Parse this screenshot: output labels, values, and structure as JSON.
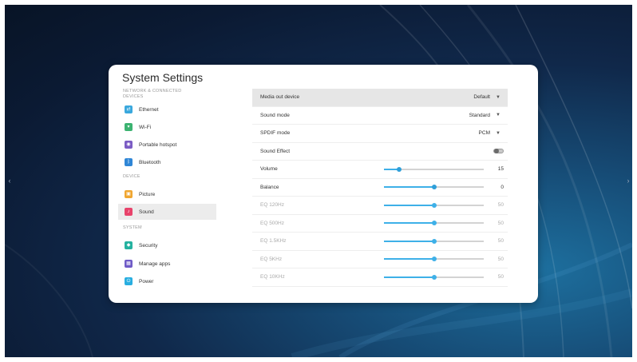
{
  "sidebar": {
    "title": "System Settings",
    "sections": [
      {
        "header": "NETWORK & CONNECTED DEVICES",
        "items": [
          {
            "label": "Ethernet",
            "icon": "ethernet-icon",
            "color": "#3aa8dd"
          },
          {
            "label": "Wi-Fi",
            "icon": "wifi-icon",
            "color": "#3cb371"
          },
          {
            "label": "Portable hotspot",
            "icon": "hotspot-icon",
            "color": "#7b5cc4"
          },
          {
            "label": "Bluetooth",
            "icon": "bluetooth-icon",
            "color": "#2f86d6"
          }
        ]
      },
      {
        "header": "DEVICE",
        "items": [
          {
            "label": "Picture",
            "icon": "picture-icon",
            "color": "#f0a630"
          },
          {
            "label": "Sound",
            "icon": "sound-icon",
            "color": "#e8436b",
            "active": true
          }
        ]
      },
      {
        "header": "SYSTEM",
        "items": [
          {
            "label": "Security",
            "icon": "security-icon",
            "color": "#25b2a0"
          },
          {
            "label": "Manage apps",
            "icon": "apps-icon",
            "color": "#6f5bc7"
          },
          {
            "label": "Power",
            "icon": "power-icon",
            "color": "#28aee0"
          }
        ]
      }
    ]
  },
  "sound": {
    "media_out_device": {
      "label": "Media out device",
      "value": "Default"
    },
    "sound_mode": {
      "label": "Sound mode",
      "value": "Standard"
    },
    "spdif_mode": {
      "label": "SPDIF mode",
      "value": "PCM"
    },
    "sound_effect": {
      "label": "Sound Effect",
      "on": false
    },
    "sliders": [
      {
        "label": "Volume",
        "value": "15",
        "level": 0.15,
        "enabled": true
      },
      {
        "label": "Balance",
        "value": "0",
        "level": 0.5,
        "enabled": true
      },
      {
        "label": "EQ 120Hz",
        "value": "50",
        "level": 0.5,
        "enabled": false
      },
      {
        "label": "EQ 500Hz",
        "value": "50",
        "level": 0.5,
        "enabled": false
      },
      {
        "label": "EQ 1.5KHz",
        "value": "50",
        "level": 0.5,
        "enabled": false
      },
      {
        "label": "EQ 5KHz",
        "value": "50",
        "level": 0.5,
        "enabled": false
      },
      {
        "label": "EQ 10KHz",
        "value": "50",
        "level": 0.5,
        "enabled": false
      }
    ]
  },
  "icons": {
    "dropdown": "dropdown-icon",
    "edge_left": "chevron-left-icon",
    "edge_right": "chevron-right-icon"
  },
  "colors": {
    "accent": "#3eb0e8",
    "active_background": "#ececec"
  }
}
